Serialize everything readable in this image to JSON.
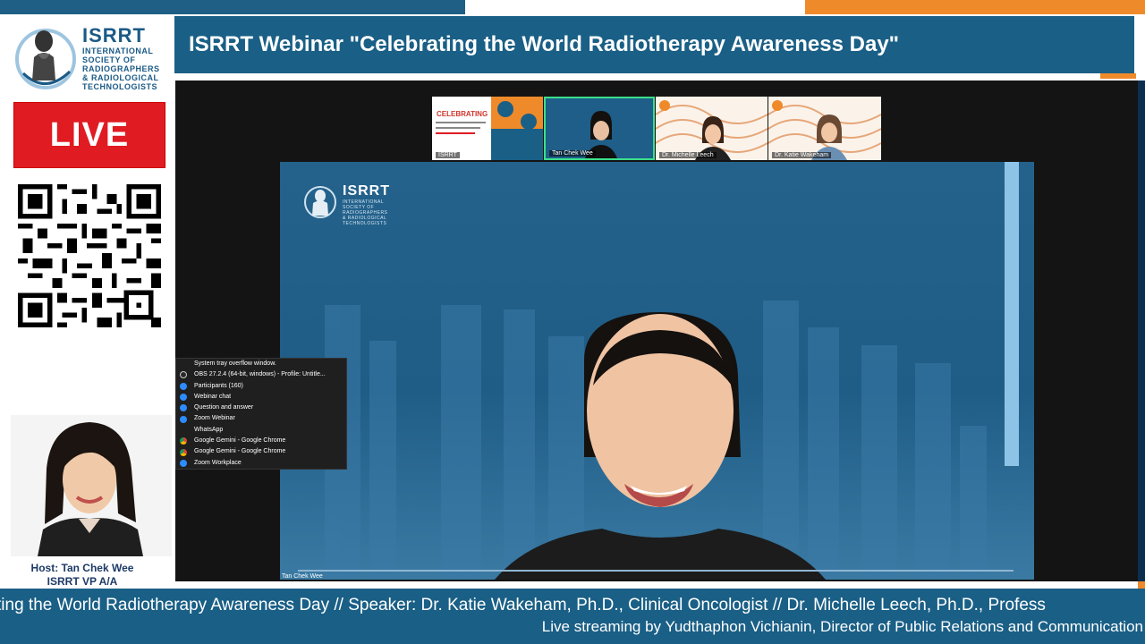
{
  "logo": {
    "title": "ISRRT",
    "subtitle": "INTERNATIONAL\nSOCIETY OF\nRADIOGRAPHERS\n& RADIOLOGICAL\nTECHNOLOGISTS"
  },
  "live_badge": "LIVE",
  "host": {
    "line1": "Host: Tan Chek Wee",
    "line2": "ISRRT VP A/A"
  },
  "banner_title": "ISRRT Webinar \"Celebrating the World Radiotherapy Awareness Day\"",
  "participants": [
    {
      "label": "ISRRT",
      "slide_heading": "CELEBRATING"
    },
    {
      "label": "Tan Chek Wee"
    },
    {
      "label": "Dr. Michelle Leech"
    },
    {
      "label": "Dr. Katie Wakeham"
    }
  ],
  "main_video": {
    "logo_title": "ISRRT",
    "logo_subtitle": "INTERNATIONAL\nSOCIETY OF\nRADIOGRAPHERS\n& RADIOLOGICAL\nTECHNOLOGISTS",
    "name_tag": "Tan Chek Wee"
  },
  "tray_menu": {
    "items": [
      {
        "label": "System tray overflow window.",
        "icon": "none"
      },
      {
        "label": "OBS 27.2.4 (64-bit, windows) - Profile: Untitle...",
        "icon": "obs-icon"
      },
      {
        "label": "Participants (160)",
        "icon": "zoom-icon"
      },
      {
        "label": "Webinar chat",
        "icon": "zoom-icon"
      },
      {
        "label": "Question and answer",
        "icon": "zoom-icon"
      },
      {
        "label": "Zoom Webinar",
        "icon": "zoom-icon"
      },
      {
        "label": "WhatsApp",
        "icon": "none"
      },
      {
        "label": "Google Gemini - Google Chrome",
        "icon": "chrome-icon"
      },
      {
        "label": "Google Gemini - Google Chrome",
        "icon": "chrome-icon"
      },
      {
        "label": "Zoom Workplace",
        "icon": "zoom-icon"
      }
    ]
  },
  "ticker": {
    "line1": "ting the World Radiotherapy Awareness Day  //  Speaker: Dr. Katie Wakeham, Ph.D., Clinical Oncologist  // Dr. Michelle Leech, Ph.D., Profess",
    "line2": "Live streaming by Yudthaphon Vichianin, Director of Public Relations and Communication"
  },
  "colors": {
    "brand_blue": "#1a5f86",
    "accent_orange": "#ef8a2a",
    "live_red": "#e01b22",
    "speaker_highlight": "#3be08a"
  }
}
